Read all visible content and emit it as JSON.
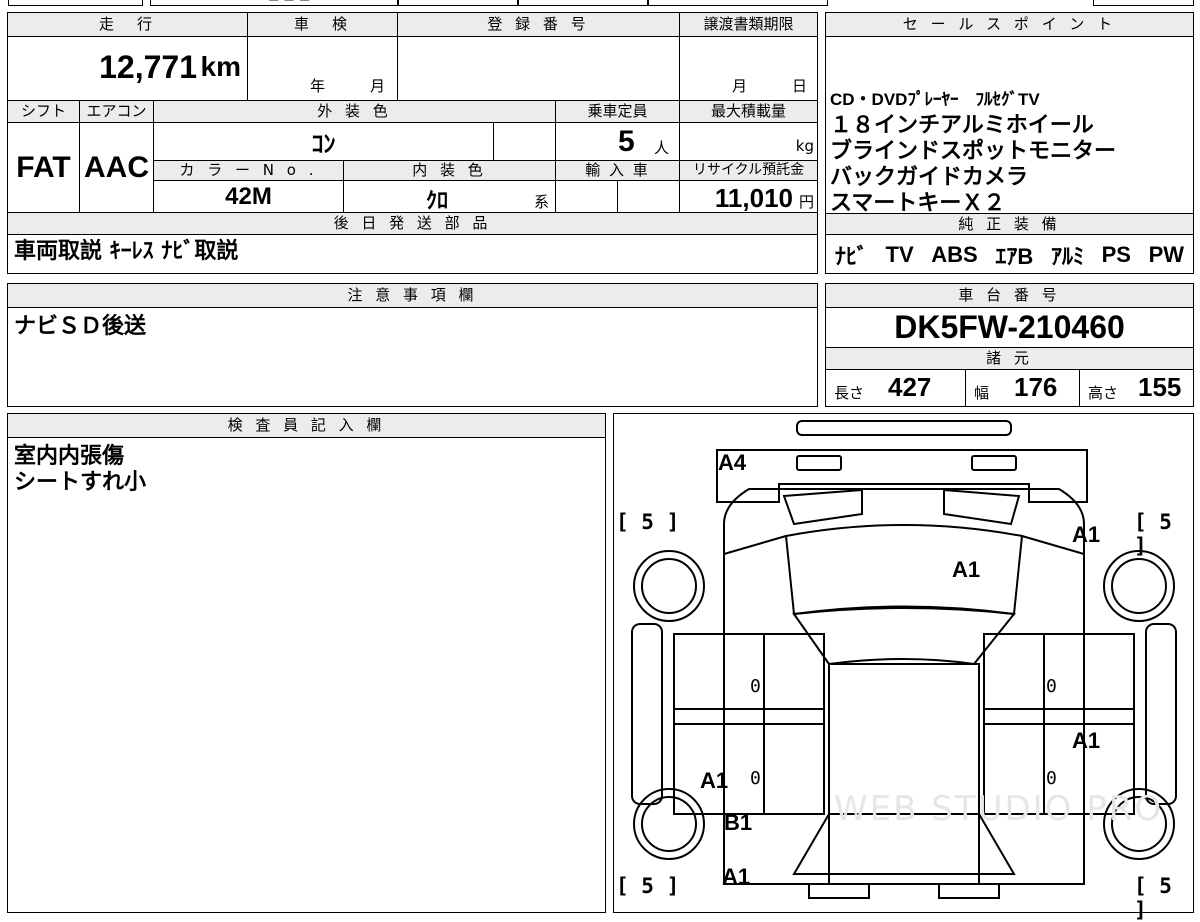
{
  "top_strip": {
    "partial_text": "■ ■ ■"
  },
  "summary": {
    "headers": {
      "mileage": "走　行",
      "inspection": "車　検",
      "registration": "登 録 番 号",
      "transfer_deadline": "譲渡書類期限",
      "shift": "シフト",
      "aircon": "エアコン",
      "exterior_color": "外 装 色",
      "capacity": "乗車定員",
      "max_load": "最大積載量",
      "color_no": "カ ラ ー N o .",
      "interior_color": "内 装 色",
      "import": "輸 入 車",
      "recycle": "リサイクル預託金",
      "later_parts": "後 日 発 送 部 品"
    },
    "mileage_value": "12,771",
    "mileage_unit": "km",
    "inspection_year_unit": "年",
    "inspection_month_unit": "月",
    "transfer_month_unit": "月",
    "transfer_day_unit": "日",
    "shift_value": "FAT",
    "aircon_value": "AAC",
    "exterior_color_value": "ｺﾝ",
    "capacity_value": "5",
    "capacity_unit": "人",
    "max_load_unit": "kg",
    "color_no_value": "42M",
    "interior_color_value": "ｸﾛ",
    "interior_color_suffix": "系",
    "recycle_value": "11,010",
    "recycle_unit": "円",
    "later_parts_value": "車両取説 ｷｰﾚｽ ﾅﾋﾞ取説"
  },
  "sales_points": {
    "header": "セ ー ル ス ポ イ ン ト",
    "lines": [
      "CD・DVDﾌﾟﾚｰﾔｰ　ﾌﾙｾｸﾞTV",
      "１８インチアルミホイール",
      "ブラインドスポットモニター",
      "バックガイドカメラ",
      "スマートキーＸ２"
    ]
  },
  "equipment": {
    "header": "純 正 装 備",
    "items": [
      "ﾅﾋﾞ",
      "TV",
      "ABS",
      "ｴｱB",
      "ｱﾙﾐ",
      "PS",
      "PW"
    ]
  },
  "notes": {
    "header": "注 意 事 項 欄",
    "text": "ナビＳＤ後送"
  },
  "chassis": {
    "header": "車 台 番 号",
    "number": "DK5FW-210460",
    "spec_header": "諸 元",
    "length_label": "長さ",
    "length_value": "427",
    "width_label": "幅",
    "width_value": "176",
    "height_label": "高さ",
    "height_value": "155"
  },
  "inspector": {
    "header": "検 査 員 記 入 欄",
    "lines": [
      "室内内張傷",
      "シートすれ小"
    ]
  },
  "diagram": {
    "marks": [
      {
        "id": "a4-rear-bumper",
        "text": "A4"
      },
      {
        "id": "a1-roof",
        "text": "A1"
      },
      {
        "id": "a1-right-front-fender",
        "text": "A1"
      },
      {
        "id": "a1-right-rear-door",
        "text": "A1"
      },
      {
        "id": "a1-left-front-door",
        "text": "A1"
      },
      {
        "id": "b1-left-front-fender",
        "text": "B1"
      },
      {
        "id": "a1-front-bumper",
        "text": "A1"
      }
    ],
    "tires": [
      {
        "id": "left-rear",
        "text": "[ 5 ]"
      },
      {
        "id": "right-rear",
        "text": "[ 5 ]"
      },
      {
        "id": "left-front",
        "text": "[ 5 ]"
      },
      {
        "id": "right-front",
        "text": "[ 5 ]"
      }
    ],
    "door_zeros": [
      "0",
      "0",
      "0",
      "0"
    ],
    "watermark": "WEB STUDIO PRO"
  }
}
